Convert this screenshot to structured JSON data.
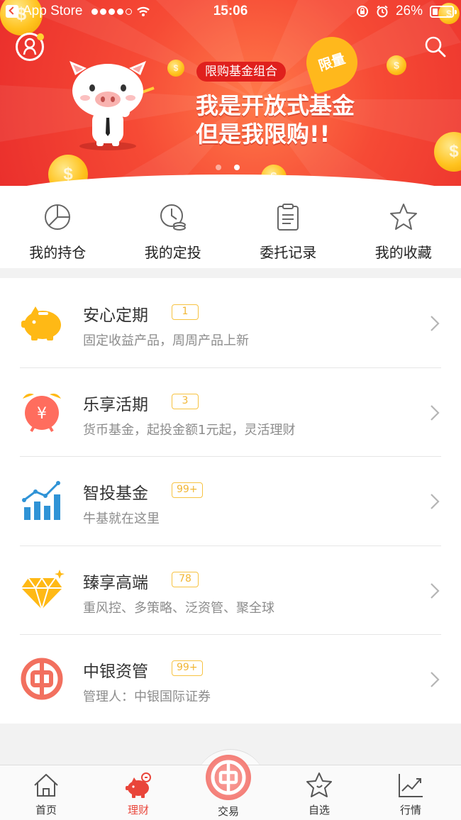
{
  "status_bar": {
    "back_app": "App Store",
    "time": "15:06",
    "battery": "26%"
  },
  "banner": {
    "tag": "限购基金组合",
    "badge": "限量",
    "line1": "我是开放式基金",
    "line2": "但是我限购!!",
    "page_index": 2,
    "page_count": 2
  },
  "quick_actions": [
    {
      "label": "我的持仓",
      "icon": "pie-chart-icon"
    },
    {
      "label": "我的定投",
      "icon": "clock-coin-icon"
    },
    {
      "label": "委托记录",
      "icon": "clipboard-icon"
    },
    {
      "label": "我的收藏",
      "icon": "star-icon"
    }
  ],
  "products": [
    {
      "title": "安心定期",
      "badge": "1",
      "subtitle": "固定收益产品，周周产品上新",
      "icon": "piggy-bank-icon"
    },
    {
      "title": "乐享活期",
      "badge": "3",
      "subtitle": "货币基金，起投金额1元起，灵活理财",
      "icon": "alarm-clock-icon"
    },
    {
      "title": "智投基金",
      "badge": "99+",
      "subtitle": "牛基就在这里",
      "icon": "bar-chart-icon"
    },
    {
      "title": "臻享高端",
      "badge": "78",
      "subtitle": "重风控、多策略、泛资管、聚全球",
      "icon": "diamond-icon"
    },
    {
      "title": "中银资管",
      "badge": "99+",
      "subtitle": "管理人：中银国际证券",
      "icon": "boc-logo-icon"
    }
  ],
  "tab_bar": [
    {
      "label": "首页",
      "icon": "home-icon",
      "active": false
    },
    {
      "label": "理财",
      "icon": "piggy-icon",
      "active": true
    },
    {
      "label": "交易",
      "icon": "boc-logo-icon",
      "active": false
    },
    {
      "label": "自选",
      "icon": "star-icon",
      "active": false
    },
    {
      "label": "行情",
      "icon": "trend-chart-icon",
      "active": false
    }
  ],
  "colors": {
    "banner_red": "#ea2f2c",
    "active_tab": "#e9453a",
    "badge_yellow": "#f7c342"
  }
}
